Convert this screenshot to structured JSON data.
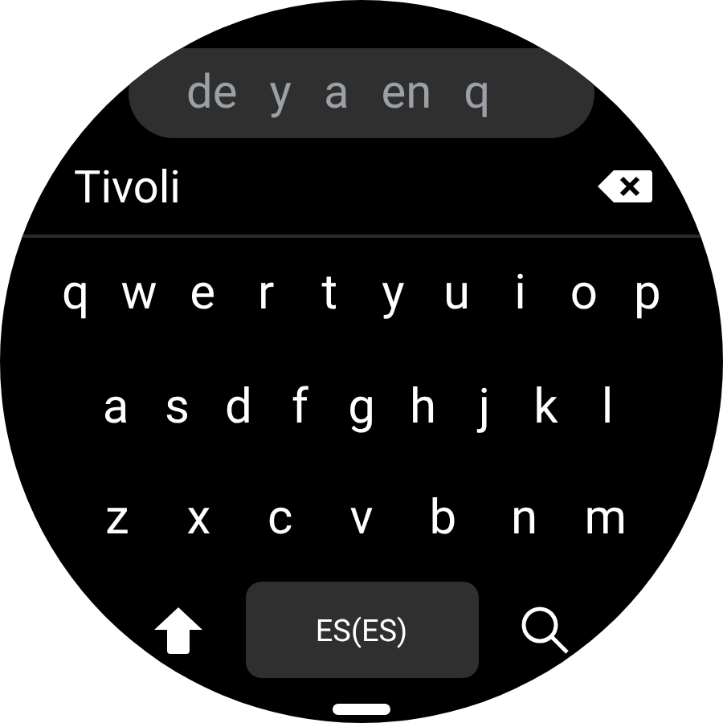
{
  "suggestions": [
    "de",
    "y",
    "a",
    "en",
    "q"
  ],
  "input": {
    "value": "Tivoli"
  },
  "keyboard": {
    "rows": [
      [
        "q",
        "w",
        "e",
        "r",
        "t",
        "y",
        "u",
        "i",
        "o",
        "p"
      ],
      [
        "a",
        "s",
        "d",
        "f",
        "g",
        "h",
        "j",
        "k",
        "l"
      ],
      [
        "z",
        "x",
        "c",
        "v",
        "b",
        "n",
        "m"
      ]
    ],
    "language": "ES(ES)"
  }
}
